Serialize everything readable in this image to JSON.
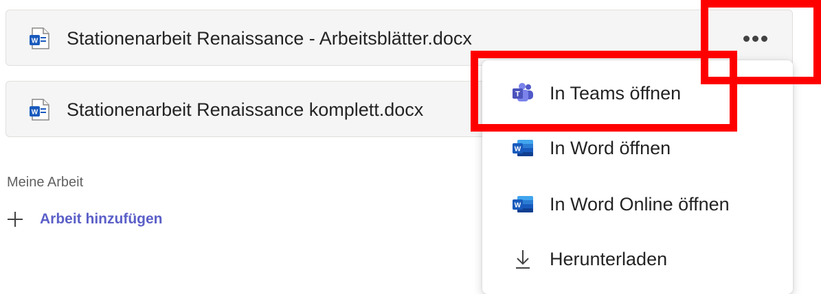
{
  "files": [
    {
      "name": "Stationenarbeit Renaissance - Arbeitsblätter.docx",
      "icon": "word-doc-icon"
    },
    {
      "name": "Stationenarbeit Renaissance komplett.docx",
      "icon": "word-doc-icon"
    }
  ],
  "more_options": {
    "icon": "more-horizontal-icon"
  },
  "my_work": {
    "section_label": "Meine Arbeit",
    "add_label": "Arbeit hinzufügen",
    "add_icon": "plus-icon"
  },
  "menu": {
    "items": [
      {
        "label": "In Teams öffnen",
        "icon": "teams-icon"
      },
      {
        "label": "In Word öffnen",
        "icon": "word-icon"
      },
      {
        "label": "In Word Online öffnen",
        "icon": "word-icon"
      },
      {
        "label": "Herunterladen",
        "icon": "download-icon"
      }
    ]
  },
  "colors": {
    "highlight": "#ff0000",
    "accent": "#5b5fc7",
    "word_blue": "#185abd",
    "teams_purple": "#5059c9"
  }
}
